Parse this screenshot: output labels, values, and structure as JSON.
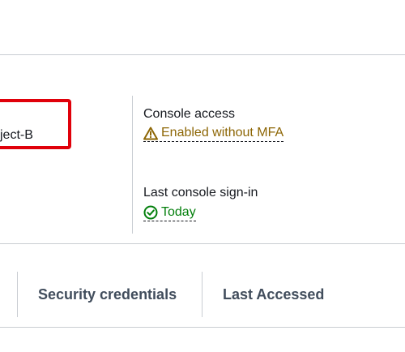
{
  "user": {
    "name_partial": "ject-B"
  },
  "console_access": {
    "label": "Console access",
    "status": "Enabled without MFA",
    "status_icon": "warning-triangle-icon",
    "status_color": "#8d6605"
  },
  "last_console_signin": {
    "label": "Last console sign-in",
    "value": "Today",
    "value_icon": "check-circle-icon",
    "value_color": "#037f0c"
  },
  "tabs": [
    {
      "label": "Security credentials"
    },
    {
      "label": "Last Accessed"
    }
  ],
  "colors": {
    "highlight_border": "#e0000a",
    "divider": "#c9cdd2",
    "tab_text": "#414d5c"
  }
}
